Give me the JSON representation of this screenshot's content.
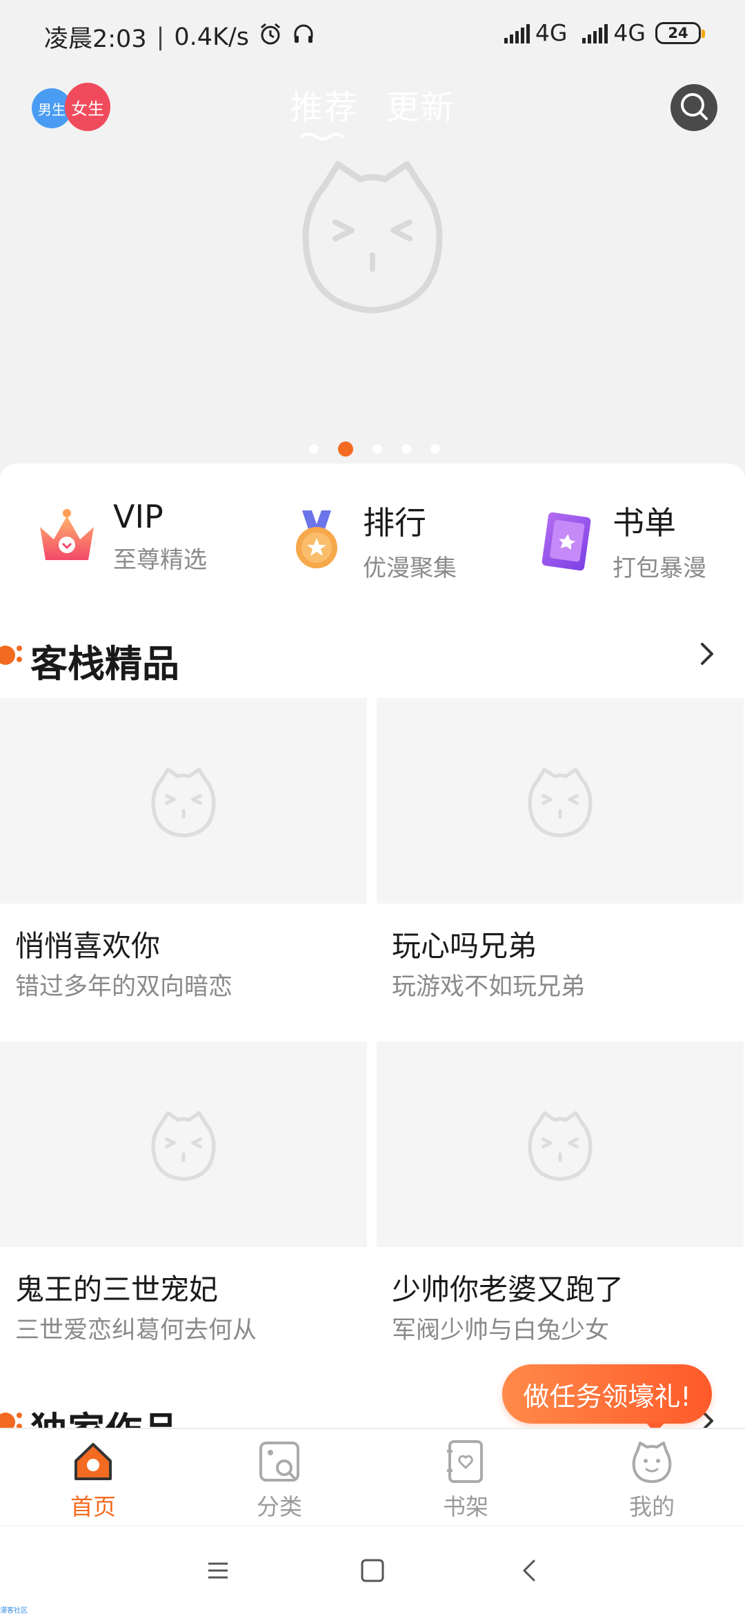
{
  "status_bar": {
    "time": "凌晨2:03",
    "speed": "0.4K/s",
    "network1": "4G",
    "network2": "4G",
    "battery": "24"
  },
  "header": {
    "gender_male": "男生",
    "gender_female": "女生",
    "tabs": [
      {
        "label": "推荐"
      },
      {
        "label": "更新"
      }
    ],
    "active_tab": "推荐"
  },
  "banner": {
    "dot_count": 5,
    "active_dot": 1
  },
  "quick_entries": [
    {
      "title": "VIP",
      "subtitle": "至尊精选",
      "icon": "crown-icon"
    },
    {
      "title": "排行",
      "subtitle": "优漫聚集",
      "icon": "medal-icon"
    },
    {
      "title": "书单",
      "subtitle": "打包暴漫",
      "icon": "book-icon"
    }
  ],
  "sections": [
    {
      "title": "客栈精品",
      "items": [
        {
          "title": "悄悄喜欢你",
          "desc": "错过多年的双向暗恋"
        },
        {
          "title": "玩心吗兄弟",
          "desc": "玩游戏不如玩兄弟"
        },
        {
          "title": "鬼王的三世宠妃",
          "desc": "三世爱恋纠葛何去何从"
        },
        {
          "title": "少帅你老婆又跑了",
          "desc": "军阀少帅与白兔少女"
        }
      ]
    },
    {
      "title": "独家作品"
    }
  ],
  "task_bubble": "做任务领壕礼!",
  "bottom_nav": [
    {
      "label": "首页",
      "icon": "home-icon",
      "active": true
    },
    {
      "label": "分类",
      "icon": "category-icon",
      "active": false
    },
    {
      "label": "书架",
      "icon": "bookshelf-icon",
      "active": false
    },
    {
      "label": "我的",
      "icon": "profile-icon",
      "active": false
    }
  ],
  "footer_tag": "漫客社区",
  "colors": {
    "accent": "#f26b21",
    "female": "#f04b5c",
    "male": "#4a9cf3"
  }
}
